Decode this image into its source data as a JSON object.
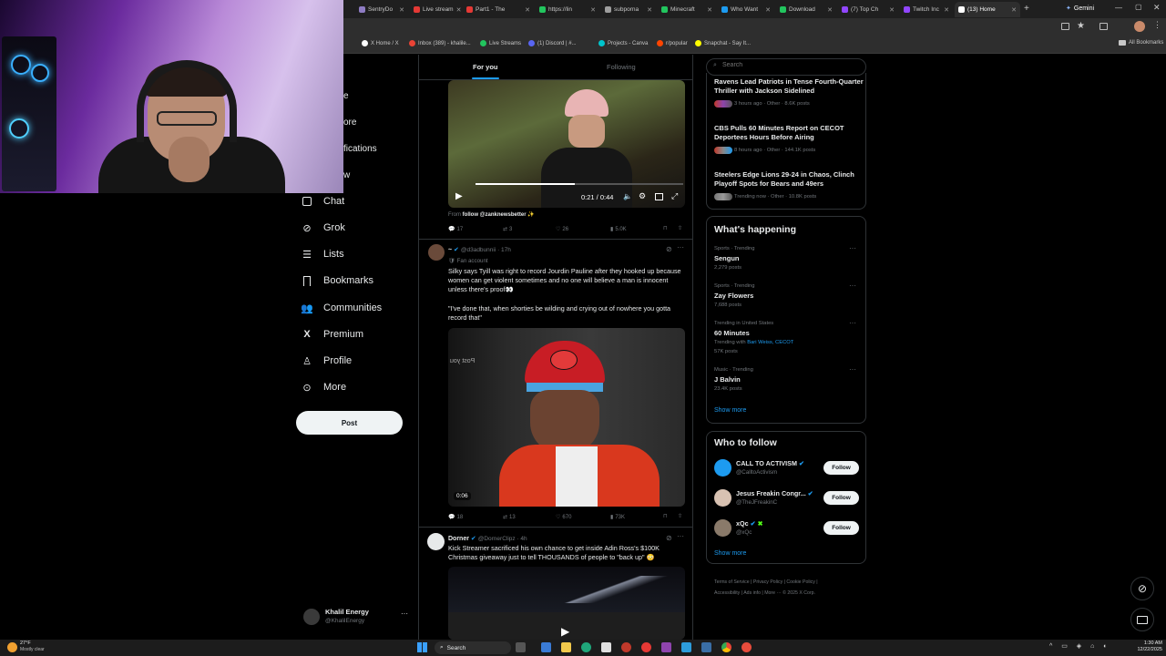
{
  "browser": {
    "tabs": [
      {
        "label": "SentryDo",
        "color": "#8e7cc3"
      },
      {
        "label": "Live stream",
        "color": "#e53935"
      },
      {
        "label": "Part1 - The",
        "color": "#e53935"
      },
      {
        "label": "https://lin",
        "color": "#22c55e"
      },
      {
        "label": "subporna",
        "color": "#9e9e9e"
      },
      {
        "label": "Minecraft",
        "color": "#22c55e"
      },
      {
        "label": "Who Want",
        "color": "#1d9bf0"
      },
      {
        "label": "Download",
        "color": "#22c55e"
      },
      {
        "label": "(7) Top Ch",
        "color": "#9146ff"
      },
      {
        "label": "Twitch Inc",
        "color": "#9146ff"
      },
      {
        "label": "(13) Home",
        "color": "#ffffff"
      }
    ],
    "gemini_label": "Gemini",
    "bookmarks": [
      {
        "label": "X Home / X",
        "color": "#ffffff"
      },
      {
        "label": "Inbox (389) - khalile...",
        "color": "#ea4335"
      },
      {
        "label": "Live Streams",
        "color": "#22c55e"
      },
      {
        "label": "(1) Discord | #...",
        "color": "#5865f2"
      },
      {
        "label": "Projects - Canva",
        "color": "#00c4cc"
      },
      {
        "label": "r/popular",
        "color": "#ff4500"
      },
      {
        "label": "Snapchat - Say It...",
        "color": "#fffc00"
      }
    ],
    "all_bookmarks": "All Bookmarks"
  },
  "sidebar": {
    "partial_items": [
      "e",
      "ore",
      "fications",
      "w"
    ],
    "items": [
      {
        "label": "Chat",
        "icon": "chat-icon"
      },
      {
        "label": "Grok",
        "icon": "grok-icon"
      },
      {
        "label": "Lists",
        "icon": "lists-icon"
      },
      {
        "label": "Bookmarks",
        "icon": "bookmark-icon"
      },
      {
        "label": "Communities",
        "icon": "communities-icon"
      },
      {
        "label": "Premium",
        "icon": "x-logo-icon"
      },
      {
        "label": "Profile",
        "icon": "profile-icon"
      },
      {
        "label": "More",
        "icon": "more-icon"
      }
    ],
    "post_label": "Post",
    "account": {
      "name": "Khalil Energy",
      "handle": "@KhalilEnergy"
    }
  },
  "feed": {
    "tabs": {
      "for_you": "For you",
      "following": "Following"
    },
    "post1": {
      "video_time": "0:21 / 0:44",
      "from_prefix": "From",
      "from_handle": "follow @zanknewsbetter ✨",
      "replies": "17",
      "reposts": "3",
      "likes": "26",
      "views": "5.0K"
    },
    "post2": {
      "name": "~",
      "handle": "@d3adbunnii · 17h",
      "badge": "Fan account",
      "text": "Silky says Tyill was right to record Jourdin Pauline after they hooked up because women can get violent sometimes and no one will believe a man is innocent unless there's proof👀",
      "quote": "\"I've done that, when shorties be wilding and crying out of nowhere you gotta record that\"",
      "overlay_text": "Post you",
      "video_time": "0:06",
      "replies": "18",
      "reposts": "13",
      "likes": "670",
      "views": "73K"
    },
    "post3": {
      "name": "Dorner",
      "handle": "@DornerClipz · 4h",
      "text": "Kick Streamer sacrificed his own chance to get inside Adin Ross's $100K Christmas giveaway just to tell THOUSANDS of people to \"back up\" 😳"
    }
  },
  "right": {
    "search_placeholder": "Search",
    "news": [
      {
        "title": "Ravens Lead Patriots in Tense Fourth-Quarter Thriller with Jackson Sidelined",
        "meta": "3 hours ago · Other · 8.6K posts"
      },
      {
        "title": "CBS Pulls 60 Minutes Report on CECOT Deportees Hours Before Airing",
        "meta": "8 hours ago · Other · 144.1K posts"
      },
      {
        "title": "Steelers Edge Lions 29-24 in Chaos, Clinch Playoff Spots for Bears and 49ers",
        "meta": "Trending now · Other · 10.8K posts"
      }
    ],
    "happening_title": "What's happening",
    "trends": [
      {
        "category": "Sports · Trending",
        "title": "Sengun",
        "count": "2,279 posts"
      },
      {
        "category": "Sports · Trending",
        "title": "Zay Flowers",
        "count": "7,688 posts"
      },
      {
        "category": "Trending in United States",
        "title": "60 Minutes",
        "with_prefix": "Trending with",
        "with_links": "Bari Weiss, CECOT",
        "count": "57K posts"
      },
      {
        "category": "Music · Trending",
        "title": "J Balvin",
        "count": "23.4K posts"
      }
    ],
    "show_more": "Show more",
    "who_title": "Who to follow",
    "who": [
      {
        "name": "CALL TO ACTIVISM",
        "handle": "@CalltoActivism",
        "button": "Follow"
      },
      {
        "name": "Jesus Freakin Congr...",
        "handle": "@TheJFreakinC",
        "button": "Follow"
      },
      {
        "name": "xQc",
        "handle": "@xQc",
        "button": "Follow"
      }
    ],
    "footer_line1": [
      "Terms of Service",
      "Privacy Policy",
      "Cookie Policy"
    ],
    "footer_line2": [
      "Accessibility",
      "Ads info",
      "More ···",
      "© 2025 X Corp."
    ]
  },
  "taskbar": {
    "weather_temp": "27°F",
    "weather_desc": "Mostly clear",
    "search_label": "Search",
    "time": "1:30 AM",
    "date": "12/22/2025"
  }
}
